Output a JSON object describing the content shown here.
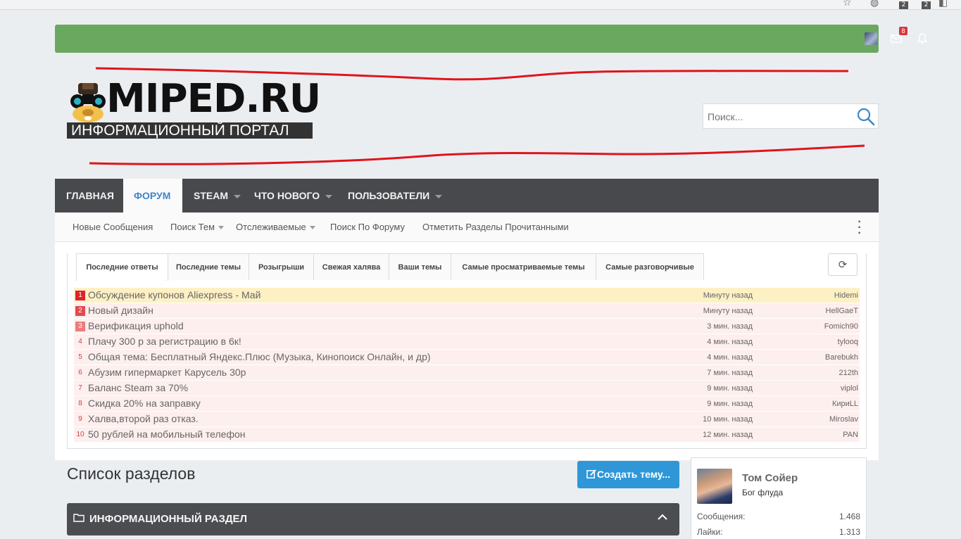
{
  "browser": {
    "ext_badges": [
      "2",
      "2"
    ]
  },
  "topbar": {
    "mail_badge": "8",
    "icons": [
      "avatar",
      "mail-icon",
      "bell-icon"
    ]
  },
  "logo": {
    "brand": "MIPED.RU",
    "tagline": "ИНФОРМАЦИОННЫЙ ПОРТАЛ"
  },
  "search": {
    "placeholder": "Поиск..."
  },
  "nav": {
    "tabs": [
      {
        "label": "ГЛАВНАЯ",
        "active": false,
        "caret": false
      },
      {
        "label": "ФОРУМ",
        "active": true,
        "caret": false
      },
      {
        "label": "STEAM",
        "active": false,
        "caret": true
      },
      {
        "label": "ЧТО НОВОГО",
        "active": false,
        "caret": true
      },
      {
        "label": "ПОЛЬЗОВАТЕЛИ",
        "active": false,
        "caret": true
      }
    ]
  },
  "subnav": {
    "items": [
      "Новые Сообщения",
      "Поиск Тем",
      "Отслеживаемые",
      "Поиск По Форуму",
      "Отметить Разделы Прочитанными"
    ]
  },
  "widget": {
    "tabs": [
      "Последние ответы",
      "Последние темы",
      "Розыгрыши",
      "Свежая халява",
      "Ваши темы",
      "Самые просматриваемые темы",
      "Самые разговорчивые"
    ],
    "rows": [
      {
        "n": "1",
        "title": "Обсуждение купонов Aliexpress - Май",
        "time": "Минуту назад",
        "user": "Hidemi"
      },
      {
        "n": "2",
        "title": "Новый дизайн",
        "time": "Минуту назад",
        "user": "HellGaeT"
      },
      {
        "n": "3",
        "title": "Верификация uphold",
        "time": "3 мин. назад",
        "user": "Fomich90"
      },
      {
        "n": "4",
        "title": "Плачу 300 р за регистрацию в 6к!",
        "time": "4 мин. назад",
        "user": "tylooq"
      },
      {
        "n": "5",
        "title": "Общая тема: Бесплатный Яндекс.Плюс (Музыка, Кинопоиск Онлайн, и др)",
        "time": "4 мин. назад",
        "user": "Barebukh"
      },
      {
        "n": "6",
        "title": "Абузим гипермаркет Карусель 30р",
        "time": "7 мин. назад",
        "user": "212th"
      },
      {
        "n": "7",
        "title": "Баланс Steam за 70%",
        "time": "9 мин. назад",
        "user": "viplol"
      },
      {
        "n": "8",
        "title": "Скидка 20% на заправку",
        "time": "9 мин. назад",
        "user": "КириLL"
      },
      {
        "n": "9",
        "title": "Халва,второй раз отказ.",
        "time": "10 мин. назад",
        "user": "Miroslav"
      },
      {
        "n": "10",
        "title": "50 рублей на мобильный телефон",
        "time": "12 мин. назад",
        "user": "PAN"
      }
    ]
  },
  "main": {
    "list_title": "Список разделов",
    "create_button": "Создать тему...",
    "section_title": "ИНФОРМАЦИОННЫЙ РАЗДЕЛ"
  },
  "profile": {
    "name": "Том Сойер",
    "rank": "Бог флуда",
    "stats": [
      {
        "label": "Сообщения:",
        "value": "1.468"
      },
      {
        "label": "Лайки:",
        "value": "1.313"
      }
    ]
  },
  "colors": {
    "topbar": "#6aa860",
    "nav": "#47494c",
    "accent": "#3f86c6",
    "button": "#2f97d8",
    "row_bg": "#fdefed",
    "row_highlight": "#fdf0c4"
  }
}
